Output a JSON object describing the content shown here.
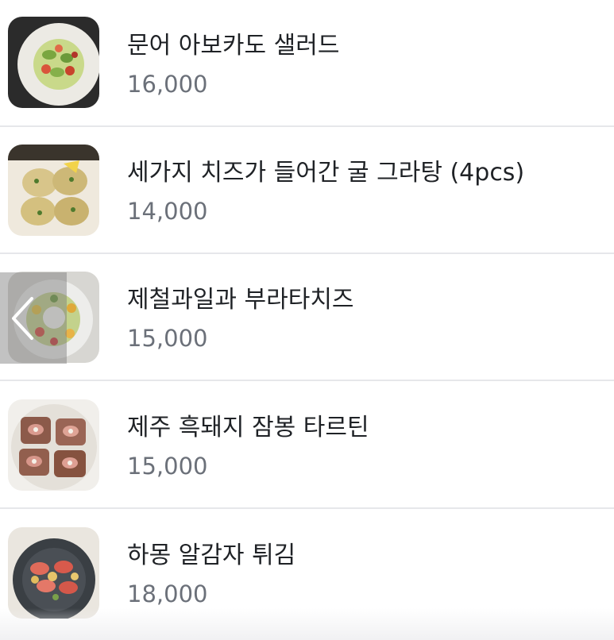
{
  "menu": {
    "items": [
      {
        "name": "문어 아보카도 샐러드",
        "price": "16,000",
        "image_icon": "octopus-avocado-salad-photo"
      },
      {
        "name": "세가지 치즈가 들어간 굴 그라탕 (4pcs)",
        "price": "14,000",
        "image_icon": "oyster-gratin-photo"
      },
      {
        "name": "제철과일과 부라타치즈",
        "price": "15,000",
        "image_icon": "fruit-burrata-photo"
      },
      {
        "name": "제주 흑돼지 잠봉 타르틴",
        "price": "15,000",
        "image_icon": "jambon-tartine-photo"
      },
      {
        "name": "하몽 알감자 튀김",
        "price": "18,000",
        "image_icon": "jamon-potato-photo"
      }
    ]
  },
  "carousel": {
    "prev_icon": "chevron-left-icon"
  },
  "colors": {
    "text_primary": "#1f2226",
    "text_secondary": "#6b7079",
    "divider": "#e6e7ea"
  }
}
